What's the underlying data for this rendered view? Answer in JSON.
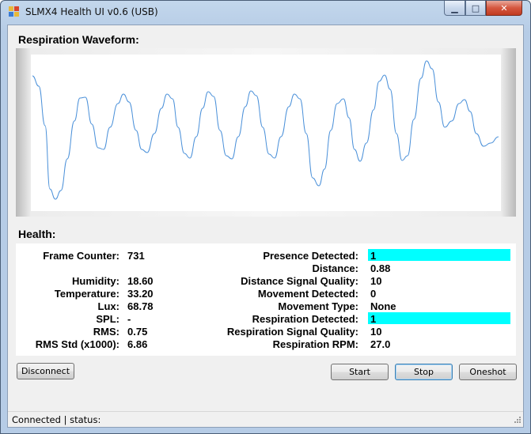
{
  "window": {
    "title": "SLMX4 Health UI v0.6 (USB)",
    "minimize_glyph": "▁",
    "maximize_glyph": "□",
    "close_glyph": "✕",
    "icon": "app-squares-icon"
  },
  "waveform": {
    "section_label": "Respiration Waveform:",
    "line_color": "#4a90d9"
  },
  "health": {
    "section_label": "Health:",
    "left": [
      {
        "label": "Frame Counter:",
        "value": "731"
      },
      {
        "label": "Humidity:",
        "value": "18.60"
      },
      {
        "label": "Temperature:",
        "value": "33.20"
      },
      {
        "label": "Lux:",
        "value": "68.78"
      },
      {
        "label": "SPL:",
        "value": "-"
      },
      {
        "label": "RMS:",
        "value": "0.75"
      },
      {
        "label": "RMS Std (x1000):",
        "value": "6.86"
      }
    ],
    "right": [
      {
        "label": "Presence Detected:",
        "value": "1"
      },
      {
        "label": "Distance:",
        "value": "0.88"
      },
      {
        "label": "Distance Signal Quality:",
        "value": "10"
      },
      {
        "label": "Movement Detected:",
        "value": "0"
      },
      {
        "label": "Movement Type:",
        "value": "None"
      },
      {
        "label": "Respiration Detected:",
        "value": "1"
      },
      {
        "label": "Respiration Signal Quality:",
        "value": "10"
      },
      {
        "label": "Respiration RPM:",
        "value": "27.0"
      }
    ],
    "highlight_color": "#00ffff"
  },
  "buttons": {
    "disconnect": "Disconnect",
    "start": "Start",
    "stop": "Stop",
    "oneshot": "Oneshot"
  },
  "status": {
    "text": "Connected  |  status:"
  }
}
